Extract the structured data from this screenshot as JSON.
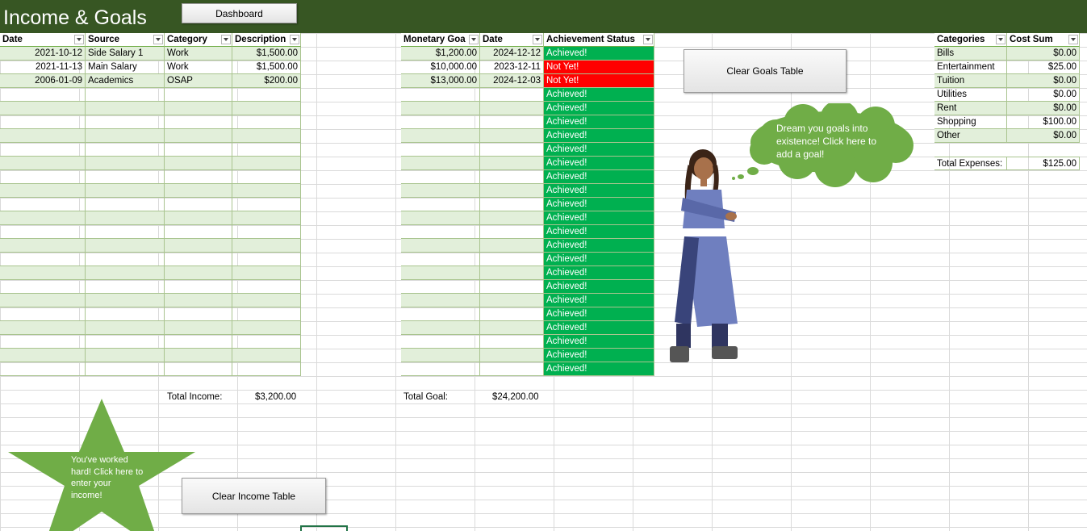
{
  "app": {
    "title": "Income & Goals"
  },
  "toolbar": {
    "dashboard_label": "Dashboard"
  },
  "income_table": {
    "headers": [
      "Date",
      "Source",
      "Category",
      "Description"
    ],
    "rows": [
      [
        "2021-10-12",
        "Side Salary 1",
        "Work",
        "$1,500.00"
      ],
      [
        "2021-11-13",
        "Main Salary",
        "Work",
        "$1,500.00"
      ],
      [
        "2006-01-09",
        "Academics",
        "OSAP",
        "$200.00"
      ]
    ],
    "total_label": "Total Income:",
    "total_value": "$3,200.00",
    "clear_label": "Clear Income Table"
  },
  "goals_table": {
    "headers": [
      "Monetary Goa",
      "Date",
      "Achievement Status"
    ],
    "rows": [
      [
        "$1,200.00",
        "2024-12-12",
        "Achieved!"
      ],
      [
        "$10,000.00",
        "2023-12-11",
        "Not Yet!"
      ],
      [
        "$13,000.00",
        "2024-12-03",
        "Not Yet!"
      ]
    ],
    "empty_status": "Achieved!",
    "total_label": "Total Goal:",
    "total_value": "$24,200.00",
    "clear_label": "Clear Goals Table"
  },
  "expenses_table": {
    "headers": [
      "Categories",
      "Cost Sum"
    ],
    "rows": [
      [
        "Bills",
        "$0.00"
      ],
      [
        "Entertainment",
        "$25.00"
      ],
      [
        "Tuition",
        "$0.00"
      ],
      [
        "Utilities",
        "$0.00"
      ],
      [
        "Rent",
        "$0.00"
      ],
      [
        "Shopping",
        "$100.00"
      ],
      [
        "Other",
        "$0.00"
      ]
    ],
    "total_label": "Total Expenses:",
    "total_value": "$125.00"
  },
  "callouts": {
    "goal_bubble": "Dream you goals into existence! Click here to add a goal!",
    "income_star": "You've worked hard! Click here to enter your income!"
  },
  "colors": {
    "header_bar": "#375623",
    "band": "#e2efda",
    "achieved": "#00b050",
    "not_yet": "#ff0000",
    "shape_green": "#70ad47"
  }
}
